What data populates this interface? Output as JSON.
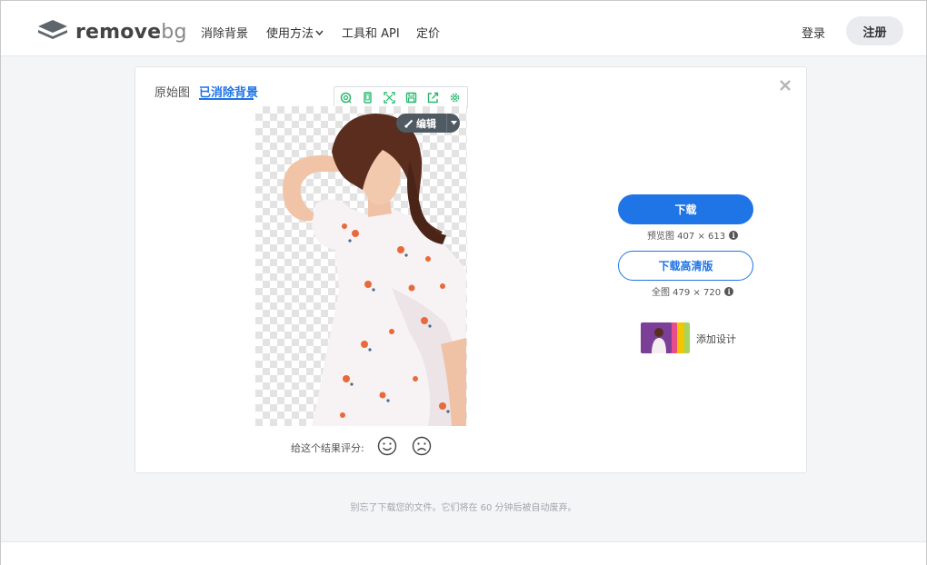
{
  "header": {
    "logo_text_main": "remove",
    "logo_text_accent": "bg",
    "nav": {
      "remove_bg": "消除背景",
      "how_to_use": "使用方法",
      "tools_api": "工具和 API",
      "pricing": "定价"
    },
    "login": "登录",
    "signup": "注册"
  },
  "result": {
    "tabs": {
      "original": "原始图",
      "removed": "已消除背景"
    },
    "edit_button": "编辑",
    "rating_label": "给这个结果评分:"
  },
  "download": {
    "download_label": "下载",
    "preview_info": "预览图 407 × 613",
    "download_hd_label": "下载高清版",
    "full_info": "全图 479 × 720",
    "add_design_label": "添加设计"
  },
  "footer": {
    "note": "别忘了下载您的文件。它们将在 60 分钟后被自动废弃。"
  },
  "colors": {
    "accent": "#1f74e6",
    "toolbar_icon": "#29b86f",
    "edit_button_bg": "#4f5a63"
  },
  "icons": {
    "logo": "layered-stack-icon",
    "toolbar": [
      "zoom-icon",
      "phone-icon",
      "expand-icon",
      "save-icon",
      "share-icon",
      "settings-icon"
    ],
    "edit": "brush-icon",
    "rating": [
      "smile-icon",
      "frown-icon"
    ],
    "info": "info-icon",
    "close": "close-icon"
  }
}
